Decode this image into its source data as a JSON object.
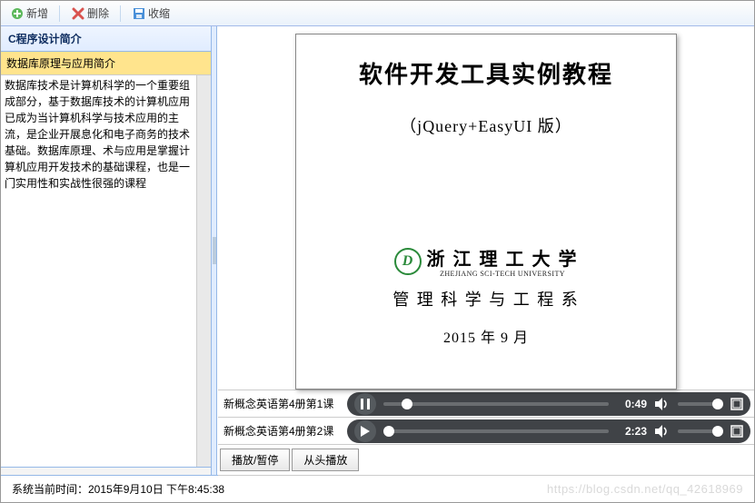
{
  "toolbar": {
    "add_label": "新增",
    "delete_label": "删除",
    "collapse_label": "收缩"
  },
  "left": {
    "header": "C程序设计简介",
    "sub_header": "数据库原理与应用简介",
    "body": "数据库技术是计算机科学的一个重要组成部分，基于数据库技术的计算机应用已成为当计算机科学与技术应用的主流，是企业开展息化和电子商务的技术基础。数据库原理、术与应用是掌握计算机应用开发技术的基础课程，也是一门实用性和实战性很强的课程",
    "footer": ""
  },
  "doc": {
    "title": "软件开发工具实例教程",
    "subtitle": "（jQuery+EasyUI 版）",
    "university": "浙 江 理 工 大 学",
    "university_en": "ZHEJIANG  SCI-TECH  UNIVERSITY",
    "department": "管 理 科 学 与 工 程 系",
    "date": "2015 年 9 月"
  },
  "media": {
    "rows": [
      {
        "label": "新概念英语第4册第1课",
        "time": "0:49",
        "state": "playing",
        "thumb_pct": 8
      },
      {
        "label": "新概念英语第4册第2课",
        "time": "2:23",
        "state": "paused",
        "thumb_pct": 0
      }
    ],
    "play_pause_label": "播放/暂停",
    "restart_label": "从头播放"
  },
  "status": {
    "text": "系统当前时间：2015年9月10日  下午8:45:38",
    "watermark": "https://blog.csdn.net/qq_42618969"
  }
}
